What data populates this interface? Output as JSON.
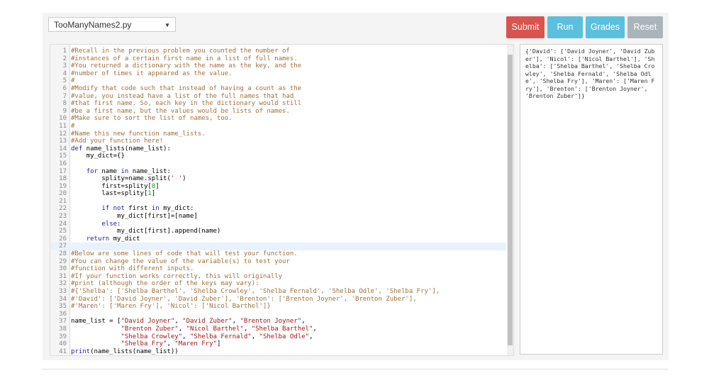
{
  "file_select": {
    "value": "TooManyNames2.py"
  },
  "buttons": {
    "submit": "Submit",
    "run": "Run",
    "grades": "Grades",
    "reset": "Reset"
  },
  "colors": {
    "submit": "#d9534f",
    "run": "#5bc0de",
    "grades": "#5bc0de",
    "reset": "#aab4bb"
  },
  "editor": {
    "active_line": 27,
    "lines": [
      "#Recall in the previous problem you counted the number of",
      "#instances of a certain first name in a list of full names.",
      "#You returned a dictionary with the name as the key, and the",
      "#number of times it appeared as the value.",
      "#",
      "#Modify that code such that instead of having a count as the",
      "#value, you instead have a list of the full names that had",
      "#that first name. So, each key in the dictionary would still",
      "#be a first name, but the values would be lists of names.",
      "#Make sure to sort the list of names, too.",
      "#",
      "#Name this new function name_lists.",
      "#Add your function here!",
      "def name_lists(name_list):",
      "    my_dict={}",
      "",
      "    for name in name_list:",
      "        splity=name.split(' ')",
      "        first=splity[0]",
      "        last=splity[1]",
      "",
      "        if not first in my_dict:",
      "            my_dict[first]=[name]",
      "        else:",
      "            my_dict[first].append(name)",
      "    return my_dict",
      "    ",
      "#Below are some lines of code that will test your function.",
      "#You can change the value of the variable(s) to test your",
      "#function with different inputs.",
      "#If your function works correctly, this will originally",
      "#print (although the order of the keys may vary):",
      "#{'Shelba': ['Shelba Barthel', 'Shelba Crowley', 'Shelba Fernald', 'Shelba Odle', 'Shelba Fry'],",
      "#'David': ['David Joyner', 'David Zuber'], 'Brenton': ['Brenton Joyner', 'Brenton Zuber'],",
      "#'Maren': ['Maren Fry'], 'Nicol': ['Nicol Barthel']}",
      "",
      "name_list = [\"David Joyner\", \"David Zuber\", \"Brenton Joyner\",",
      "             \"Brenton Zuber\", \"Nicol Barthel\", \"Shelba Barthel\",",
      "             \"Shelba Crowley\", \"Shelba Fernald\", \"Shelba Odle\",",
      "             \"Shelba Fry\", \"Maren Fry\"]",
      "print(name_lists(name_list))"
    ]
  },
  "output": {
    "text": "{'David': ['David Joyner', 'David Zuber'], 'Nicol': ['Nicol Barthel'], 'Shelba': ['Shelba Barthel', 'Shelba Crowley', 'Shelba Fernald', 'Shelba Odle', 'Shelba Fry'], 'Maren': ['Maren Fry'], 'Brenton': ['Brenton Joyner', 'Brenton Zuber']}"
  }
}
